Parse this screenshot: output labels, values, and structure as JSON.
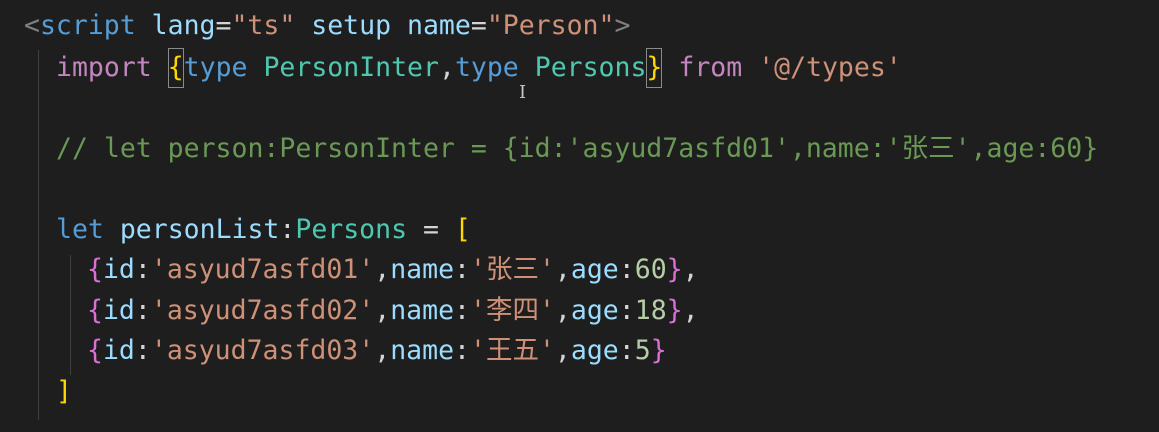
{
  "code": {
    "line1": {
      "lt": "<",
      "tag": "script",
      "attr1": "lang",
      "eq1": "=",
      "val1": "\"ts\"",
      "attr2": "setup",
      "attr3": "name",
      "eq2": "=",
      "val3": "\"Person\"",
      "gt": ">"
    },
    "line2": {
      "kw_import": "import",
      "brace_open": "{",
      "kw_type1": "type",
      "type1": "PersonInter",
      "comma": ",",
      "kw_type2": "type",
      "type2": "Persons",
      "brace_close": "}",
      "kw_from": "from",
      "path": "'@/types'"
    },
    "line4": {
      "comment": "// let person:PersonInter = {id:'asyud7asfd01',name:'张三',age:60}"
    },
    "line6": {
      "kw_let": "let",
      "var": "personList",
      "colon": ":",
      "type": "Persons",
      "eq": " = ",
      "bracket_open": "["
    },
    "items": [
      {
        "brace_open": "{",
        "k_id": "id",
        "id": "'asyud7asfd01'",
        "k_name": "name",
        "name": "'张三'",
        "k_age": "age",
        "age": "60",
        "brace_close": "}",
        "tail": ","
      },
      {
        "brace_open": "{",
        "k_id": "id",
        "id": "'asyud7asfd02'",
        "k_name": "name",
        "name": "'李四'",
        "k_age": "age",
        "age": "18",
        "brace_close": "}",
        "tail": ","
      },
      {
        "brace_open": "{",
        "k_id": "id",
        "id": "'asyud7asfd03'",
        "k_name": "name",
        "name": "'王五'",
        "k_age": "age",
        "age": "5",
        "brace_close": "}",
        "tail": ""
      }
    ],
    "line10": {
      "bracket_close": "]"
    },
    "cursor_glyph": "I"
  },
  "colors": {
    "background": "#1e1e1e",
    "keyword": "#c586c0",
    "type": "#4ec9b0",
    "string": "#ce9178",
    "number": "#b5cea8",
    "comment": "#6a9955",
    "variable": "#9cdcfe"
  }
}
